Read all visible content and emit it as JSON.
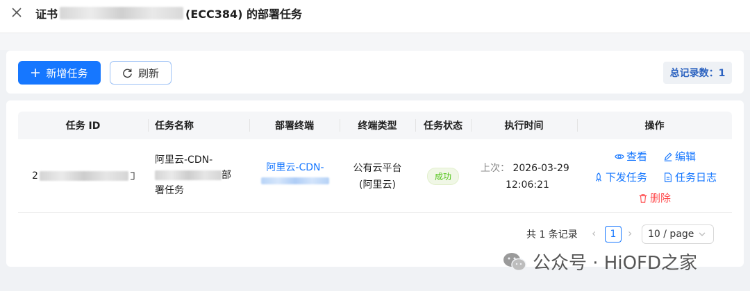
{
  "header": {
    "title_prefix": "证书",
    "title_suffix": "(ECC384) 的部署任务",
    "close_icon": "close-icon"
  },
  "toolbar": {
    "add_label": "新增任务",
    "refresh_label": "刷新",
    "total_label": "总记录数：1"
  },
  "table": {
    "columns": [
      "任务 ID",
      "任务名称",
      "部署终端",
      "终端类型",
      "任务状态",
      "执行时间",
      "操作"
    ],
    "rows": [
      {
        "id_prefix": "2",
        "name_line1": "阿里云-CDN-",
        "name_line2_suffix": "部",
        "name_line3": "署任务",
        "terminal": "阿里云-CDN-",
        "type_line1": "公有云平台",
        "type_line2": "(阿里云)",
        "status": "成功",
        "time_label": "上次：",
        "time_date": "2026-03-29",
        "time_clock": "12:06:21",
        "actions": {
          "view": "查看",
          "edit": "编辑",
          "dispatch": "下发任务",
          "log": "任务日志",
          "delete": "删除"
        }
      }
    ]
  },
  "pagination": {
    "summary": "共 1 条记录",
    "current_page": "1",
    "page_size": "10 / page"
  },
  "watermark": {
    "text": "公众号 · HiOFD之家"
  },
  "colors": {
    "primary": "#1677ff",
    "success": "#52c41a",
    "danger": "#ff4d4f"
  }
}
